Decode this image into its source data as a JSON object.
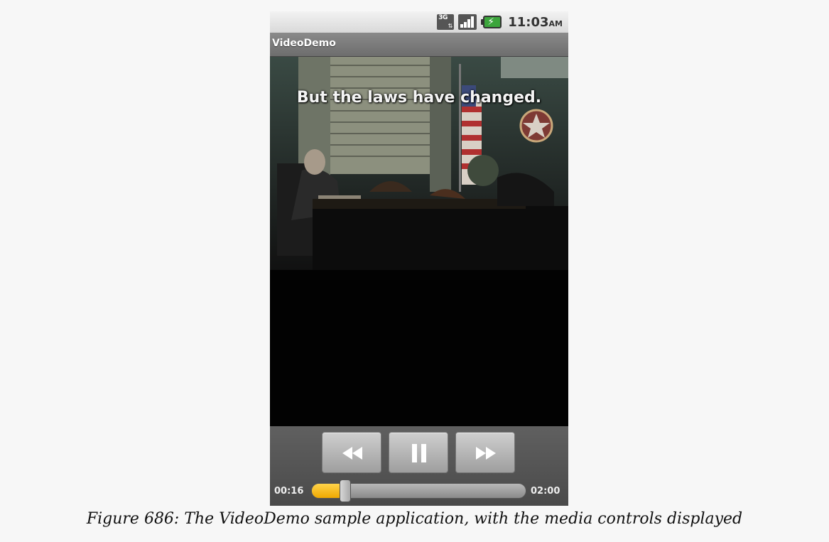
{
  "status_bar": {
    "network_label": "3G",
    "time": "11:03",
    "ampm": "AM",
    "icons": [
      "3g-data-icon",
      "signal-icon",
      "battery-charging-icon"
    ]
  },
  "app": {
    "title": "VideoDemo"
  },
  "video": {
    "subtitle": "But the laws have changed."
  },
  "controls": {
    "elapsed": "00:16",
    "duration": "02:00",
    "progress": 0.1333,
    "buttons": [
      "rewind",
      "pause",
      "fast-forward"
    ]
  },
  "caption": "Figure 686: The VideoDemo sample application, with the media controls displayed"
}
